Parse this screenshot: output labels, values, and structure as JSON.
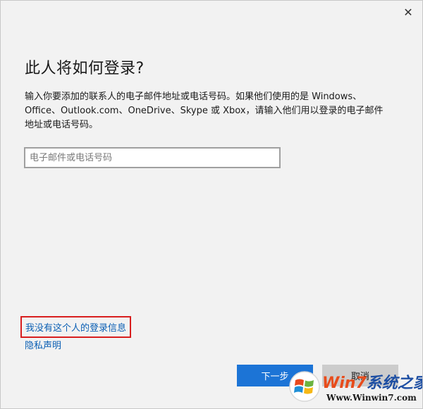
{
  "dialog": {
    "close_glyph": "✕",
    "title": "此人将如何登录?",
    "description": "输入你要添加的联系人的电子邮件地址或电话号码。如果他们使用的是 Windows、Office、Outlook.com、OneDrive、Skype 或 Xbox，请输入他们用以登录的电子邮件地址或电话号码。",
    "input": {
      "value": "",
      "placeholder": "电子邮件或电话号码"
    },
    "links": {
      "no_info": "我没有这个人的登录信息",
      "privacy": "隐私声明"
    },
    "buttons": {
      "next": "下一步",
      "cancel": "取消"
    }
  },
  "watermark": {
    "brand_part1": "Win7",
    "brand_part2": "系统之家",
    "url": "Www.Winwin7.com"
  },
  "colors": {
    "accent": "#1c74d6",
    "link": "#0a5fb4",
    "highlight_border": "#d81e1e",
    "dialog_bg": "#f2f2f2"
  },
  "icons": {
    "close": "close-icon",
    "watermark_logo": "windows-logo-icon"
  }
}
